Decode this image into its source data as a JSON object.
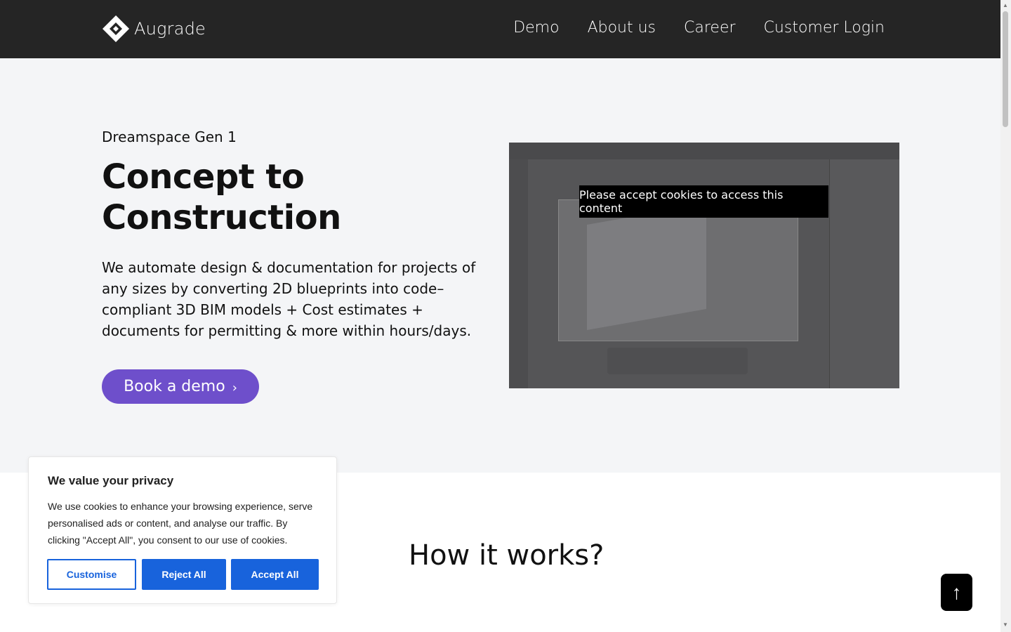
{
  "header": {
    "brand": "Augrade",
    "nav": [
      "Demo",
      "About us",
      "Career",
      "Customer Login"
    ]
  },
  "hero": {
    "eyebrow": "Dreamspace Gen 1",
    "headline": "Concept to Construction",
    "description": "We automate design & documentation for projects of any sizes by converting 2D blueprints into code–compliant 3D BIM models + Cost estimates + documents for permitting & more within hours/days.",
    "cta_label": "Book a demo",
    "cta_icon": "chevron-right-icon",
    "media_overlay": "Please accept cookies to access this content"
  },
  "section2": {
    "title": "How it works?"
  },
  "cookie": {
    "title": "We value your privacy",
    "body": "We use cookies to enhance your browsing experience, serve personalised ads or content, and analyse our traffic. By clicking \"Accept All\", you consent to our use of cookies.",
    "customise": "Customise",
    "reject": "Reject All",
    "accept": "Accept All",
    "accent": "#1863dc"
  },
  "scroll_top_icon": "arrow-up-icon",
  "colors": {
    "header_bg": "#252525",
    "cta_bg": "#6e4fcb"
  }
}
